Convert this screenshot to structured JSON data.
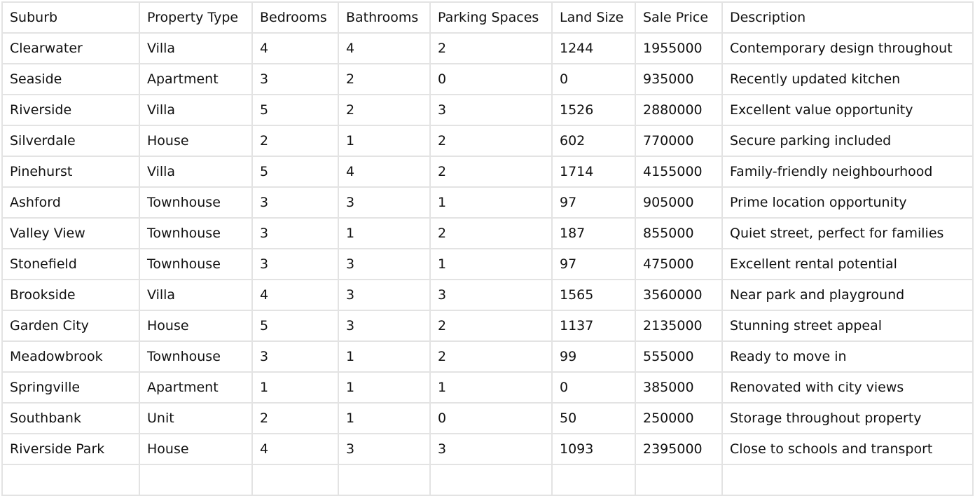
{
  "table": {
    "columns": [
      "Suburb",
      "Property Type",
      "Bedrooms",
      "Bathrooms",
      "Parking Spaces",
      "Land Size",
      "Sale Price",
      "Description"
    ],
    "rows": [
      [
        "Clearwater",
        "Villa",
        "4",
        "4",
        "2",
        "1244",
        "1955000",
        "Contemporary design throughout"
      ],
      [
        "Seaside",
        "Apartment",
        "3",
        "2",
        "0",
        "0",
        "935000",
        "Recently updated kitchen"
      ],
      [
        "Riverside",
        "Villa",
        "5",
        "2",
        "3",
        "1526",
        "2880000",
        "Excellent value opportunity"
      ],
      [
        "Silverdale",
        "House",
        "2",
        "1",
        "2",
        "602",
        "770000",
        "Secure parking included"
      ],
      [
        "Pinehurst",
        "Villa",
        "5",
        "4",
        "2",
        "1714",
        "4155000",
        "Family-friendly neighbourhood"
      ],
      [
        "Ashford",
        "Townhouse",
        "3",
        "3",
        "1",
        "97",
        "905000",
        "Prime location opportunity"
      ],
      [
        "Valley View",
        "Townhouse",
        "3",
        "1",
        "2",
        "187",
        "855000",
        "Quiet street, perfect for families"
      ],
      [
        "Stonefield",
        "Townhouse",
        "3",
        "3",
        "1",
        "97",
        "475000",
        "Excellent rental potential"
      ],
      [
        "Brookside",
        "Villa",
        "4",
        "3",
        "3",
        "1565",
        "3560000",
        "Near park and playground"
      ],
      [
        "Garden City",
        "House",
        "5",
        "3",
        "2",
        "1137",
        "2135000",
        "Stunning street appeal"
      ],
      [
        "Meadowbrook",
        "Townhouse",
        "3",
        "1",
        "2",
        "99",
        "555000",
        "Ready to move in"
      ],
      [
        "Springville",
        "Apartment",
        "1",
        "1",
        "1",
        "0",
        "385000",
        "Renovated with city views"
      ],
      [
        "Southbank",
        "Unit",
        "2",
        "1",
        "0",
        "50",
        "250000",
        "Storage throughout property"
      ],
      [
        "Riverside Park",
        "House",
        "4",
        "3",
        "3",
        "1093",
        "2395000",
        "Close to schools and transport"
      ],
      [
        "",
        "",
        "",
        "",
        "",
        "",
        "",
        ""
      ]
    ]
  }
}
